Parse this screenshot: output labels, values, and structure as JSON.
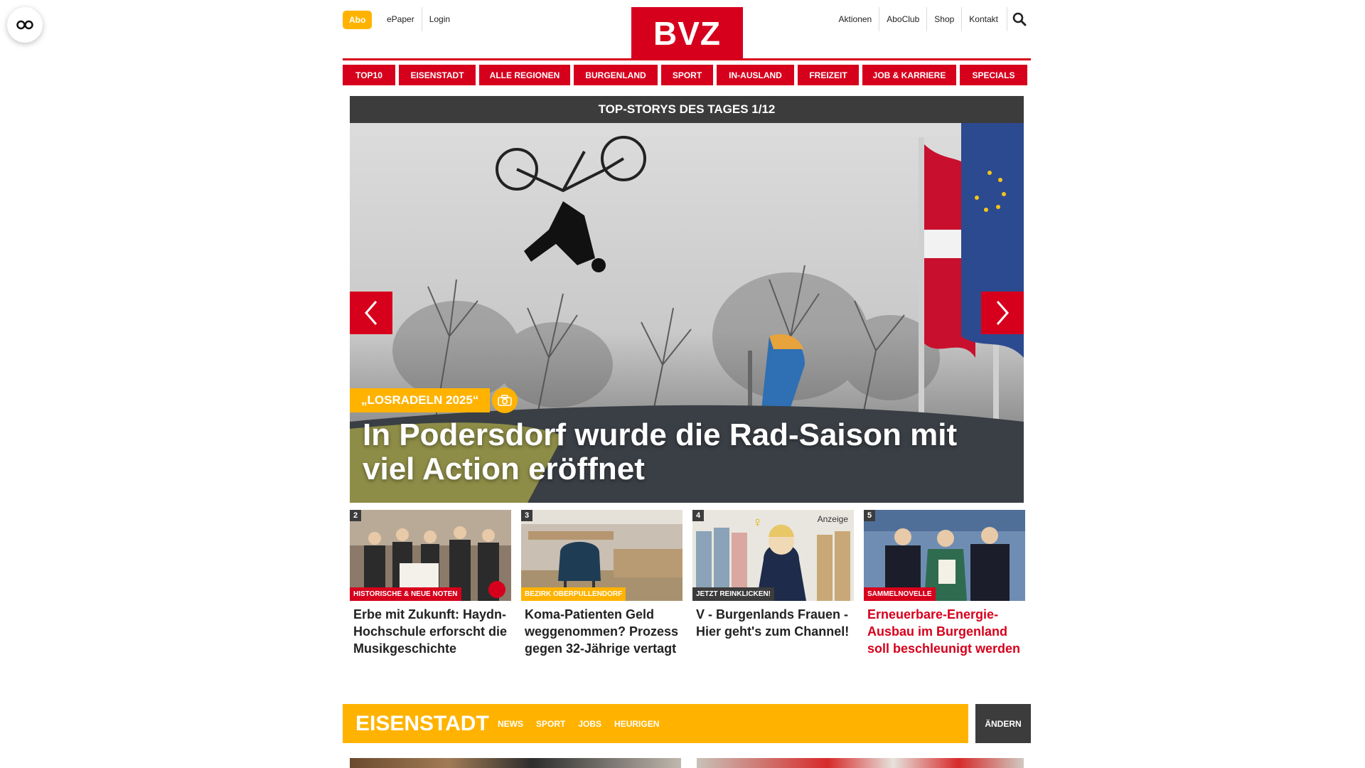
{
  "header": {
    "abo_label": "Abo",
    "left_links": [
      "ePaper",
      "Login"
    ],
    "logo_text": "BVZ",
    "right_links": [
      "Aktionen",
      "AboClub",
      "Shop",
      "Kontakt"
    ]
  },
  "nav": {
    "items": [
      "TOP10",
      "EISENSTADT",
      "ALLE REGIONEN",
      "BURGENLAND",
      "SPORT",
      "IN-AUSLAND",
      "FREIZEIT",
      "JOB & KARRIERE",
      "SPECIALS"
    ]
  },
  "top_stories": {
    "heading": "TOP-STORYS DES TAGES 1/12",
    "hero": {
      "kicker": "„LOSRADELN 2025“",
      "title": "In Podersdorf wurde die Rad-Saison mit viel Action eröffnet"
    },
    "cards": [
      {
        "num": "2",
        "tag": "HISTORISCHE & NEUE NOTEN",
        "title": "Erbe mit Zukunft: Haydn-Hochschule erforscht die Musikgeschichte"
      },
      {
        "num": "3",
        "tag": "BEZIRK OBERPULLENDORF",
        "title": "Koma-Patienten Geld weggenommen? Prozess gegen 32-Jährige vertagt"
      },
      {
        "num": "4",
        "tag": "JETZT REINKLICKEN!",
        "title": "V - Burgenlands Frauen - Hier geht's zum Channel!",
        "badge": "Anzeige"
      },
      {
        "num": "5",
        "tag": "SAMMELNOVELLE",
        "title": "Erneuerbare-Energie-Ausbau im Burgenland soll beschleunigt werden"
      }
    ]
  },
  "region": {
    "title": "EISENSTADT",
    "links": [
      "NEWS",
      "SPORT",
      "JOBS",
      "HEURIGEN"
    ],
    "change_label": "ÄNDERN"
  },
  "colors": {
    "brand_red": "#d6001c",
    "accent_yellow": "#ffb300",
    "dark_gray": "#3c3c3c"
  }
}
